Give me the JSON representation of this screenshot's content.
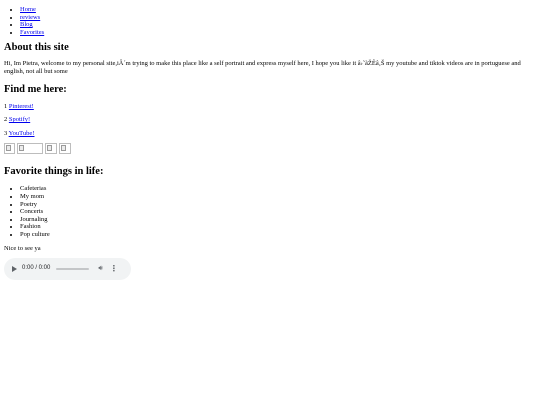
{
  "nav": [
    {
      "label": "Home"
    },
    {
      "label": "reviews"
    },
    {
      "label": "Blog"
    },
    {
      "label": "Favorites"
    }
  ],
  "about": {
    "heading": "About this site",
    "text": "Hi, Im Pietra, welcome to my personal site,iÂ´m trying to make this place like a self portrait and express myself here, I hope you like it â›˜ãŽÊâ‚Š my youtube and tiktok videos are in portuguese and english, not all but some"
  },
  "find": {
    "heading": "Find me here:",
    "items": [
      {
        "num": "1",
        "label": "Pinterest!"
      },
      {
        "num": "2",
        "label": "Spotify!"
      },
      {
        "num": "3",
        "label": "YouTube!"
      }
    ]
  },
  "favorites": {
    "heading": "Favorite things in life:",
    "items": [
      "Cafeterias",
      "My mom",
      "Poetry",
      "Concerts",
      "Journaling",
      "Fashion",
      "Pop culture"
    ]
  },
  "footer_text": "Nice to see ya",
  "audio": {
    "time": "0:00 / 0:00",
    "play_icon": "play-icon",
    "volume_icon": "volume-icon",
    "more_icon": "more-options-icon",
    "progress": 0
  }
}
